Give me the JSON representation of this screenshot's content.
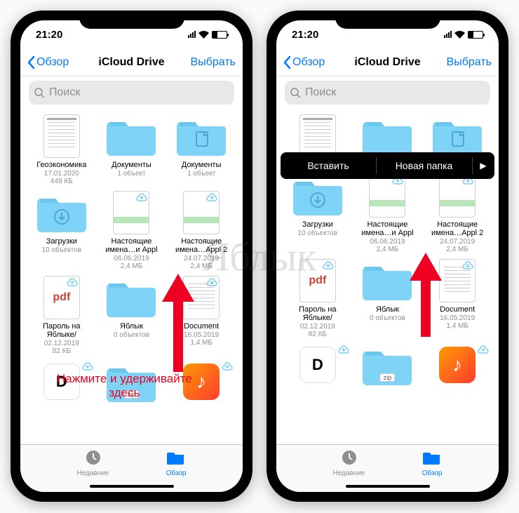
{
  "watermark": "Яблык",
  "statusbar": {
    "time": "21:20"
  },
  "navbar": {
    "back": "Обзор",
    "title": "iCloud Drive",
    "select": "Выбрать"
  },
  "search": {
    "placeholder": "Поиск"
  },
  "tabs": {
    "recent": "Недавние",
    "browse": "Обзор"
  },
  "annotation": {
    "press_hold": "Нажмите и удерживайте\nздесь",
    "line1": "Нажмите и удерживайте",
    "line2": "здесь"
  },
  "context_menu": {
    "paste": "Вставить",
    "new_folder": "Новая папка",
    "more": "▶"
  },
  "items": [
    {
      "label": "Геоэкономика",
      "sub": "17.01.2020",
      "sub2": "449 КБ",
      "kind": "doc-geo"
    },
    {
      "label": "Документы",
      "sub": "1 объект",
      "sub2": "",
      "kind": "folder"
    },
    {
      "label": "Документы",
      "sub": "1 объект",
      "sub2": "",
      "kind": "folder-doc"
    },
    {
      "label": "Загрузки",
      "sub": "10 объектов",
      "sub2": "",
      "kind": "folder-down"
    },
    {
      "label": "Настоящие имена…и Appl",
      "sub": "06.06.2019",
      "sub2": "2,4 МБ",
      "kind": "doc-img",
      "cloud": true
    },
    {
      "label": "Настоящие имена…Appl 2",
      "sub": "24.07.2019",
      "sub2": "2,4 МБ",
      "kind": "doc-img",
      "cloud": true
    },
    {
      "label": "Пароль на Яблыке/",
      "sub": "02.12.2019",
      "sub2": "82 КБ",
      "kind": "pdf",
      "cloud": true
    },
    {
      "label": "Яблык",
      "sub": "0 объектов",
      "sub2": "",
      "kind": "folder"
    },
    {
      "label": "Document",
      "sub": "16.05.2019",
      "sub2": "1,4 МБ",
      "kind": "doc-plain",
      "cloud": true
    },
    {
      "label": "",
      "sub": "",
      "sub2": "",
      "kind": "app-d",
      "cloud": true
    },
    {
      "label": "",
      "sub": "",
      "sub2": "",
      "kind": "folder-zip"
    },
    {
      "label": "",
      "sub": "",
      "sub2": "",
      "kind": "app-g",
      "cloud": true
    }
  ]
}
